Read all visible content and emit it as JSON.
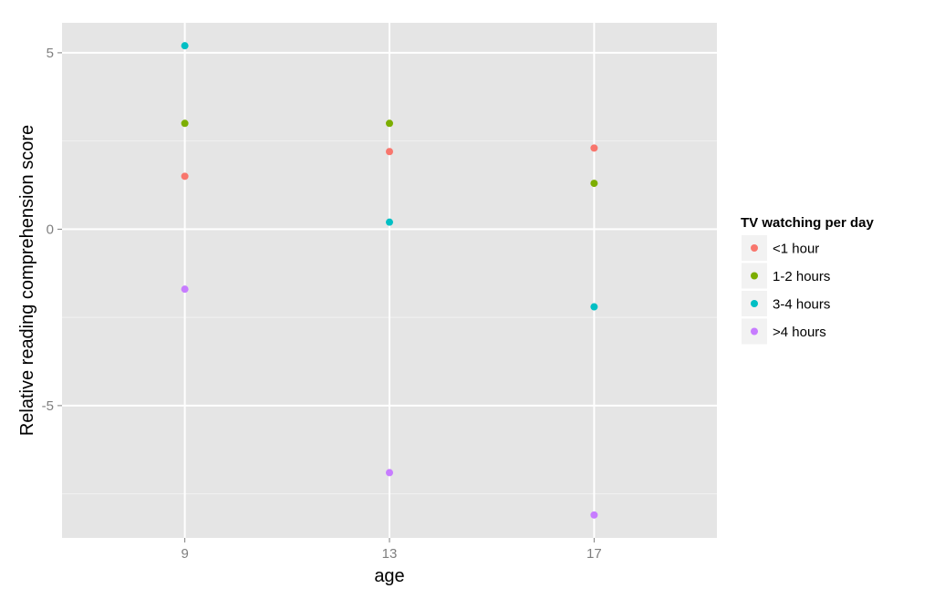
{
  "chart_data": {
    "type": "scatter",
    "title": "",
    "xlabel": "age",
    "ylabel": "Relative reading comprehension score",
    "x_type": "discrete",
    "categories": [
      "9",
      "13",
      "17"
    ],
    "x_values": [
      9,
      13,
      17
    ],
    "xlim": [
      6.6,
      19.4
    ],
    "ylim": [
      -8.75,
      5.85
    ],
    "y_ticks": [
      -5,
      0,
      5
    ],
    "y_tick_labels": [
      "-5",
      "0",
      "5"
    ],
    "y_minor_ticks": [
      -7.5,
      -2.5,
      2.5
    ],
    "grid": true,
    "legend": {
      "title": "TV watching per day",
      "position": "right"
    },
    "series": [
      {
        "name": "<1 hour",
        "color": "#F8766D",
        "x": [
          9,
          13,
          17
        ],
        "y": [
          1.5,
          2.2,
          2.3
        ]
      },
      {
        "name": "1-2 hours",
        "color": "#7CAE00",
        "x": [
          9,
          13,
          17
        ],
        "y": [
          3.0,
          3.0,
          1.3
        ]
      },
      {
        "name": "3-4 hours",
        "color": "#00BFC4",
        "x": [
          9,
          13,
          17
        ],
        "y": [
          5.2,
          0.2,
          -2.2
        ]
      },
      {
        "name": ">4 hours",
        "color": "#C77CFF",
        "x": [
          9,
          13,
          17
        ],
        "y": [
          -1.7,
          -6.9,
          -8.1
        ]
      }
    ],
    "colors": {
      "panel_background": "#E5E5E5",
      "grid_major": "#FFFFFF",
      "grid_minor": "#F2F2F2",
      "tick_text": "#7F7F7F",
      "legend_key_background": "#F2F2F2"
    }
  }
}
